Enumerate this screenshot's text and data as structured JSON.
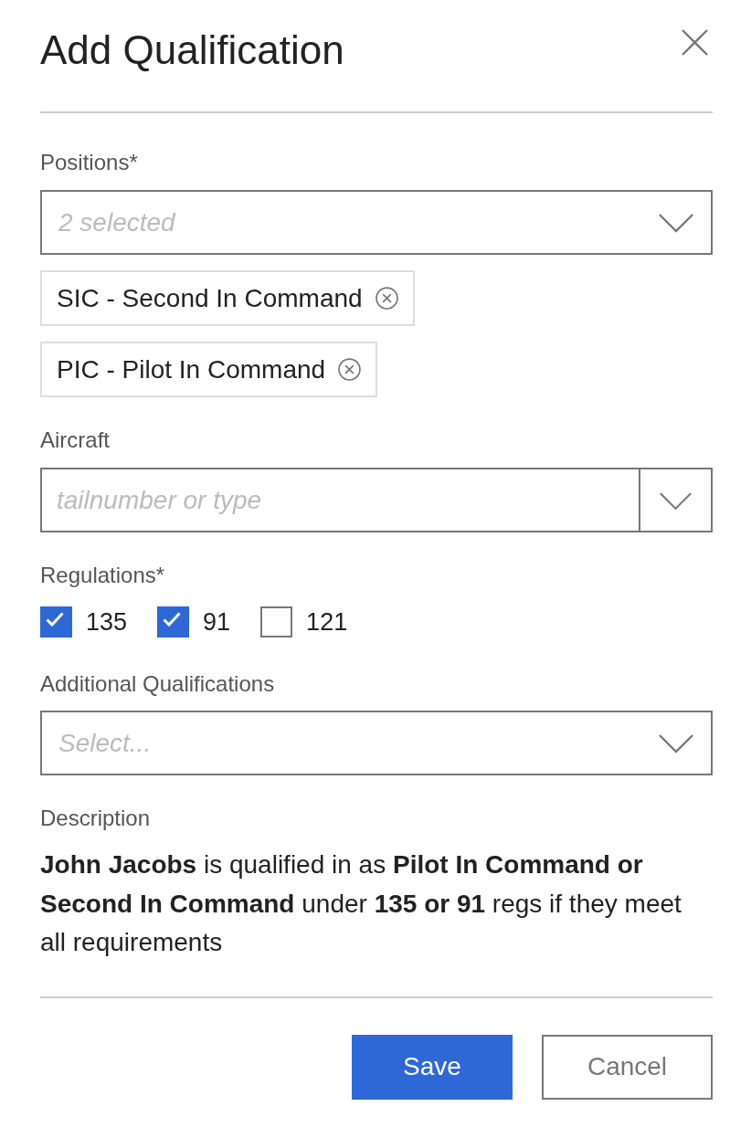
{
  "dialog": {
    "title": "Add Qualification"
  },
  "positions": {
    "label": "Positions*",
    "placeholder": "2 selected",
    "tags": [
      {
        "label": "SIC - Second In Command"
      },
      {
        "label": "PIC - Pilot In Command"
      }
    ]
  },
  "aircraft": {
    "label": "Aircraft",
    "placeholder": "tailnumber or type"
  },
  "regulations": {
    "label": "Regulations*",
    "options": [
      {
        "label": "135",
        "checked": true
      },
      {
        "label": "91",
        "checked": true
      },
      {
        "label": "121",
        "checked": false
      }
    ]
  },
  "additional_qualifications": {
    "label": "Additional Qualifications",
    "placeholder": "Select..."
  },
  "description": {
    "label": "Description",
    "text": "**John Jacobs** is qualified in as **Pilot In Command or Second In Command** under **135 or 91** regs if they meet all requirements"
  },
  "buttons": [
    {
      "label": "Save",
      "kind": "primary"
    },
    {
      "label": "Cancel",
      "kind": "secondary"
    }
  ]
}
